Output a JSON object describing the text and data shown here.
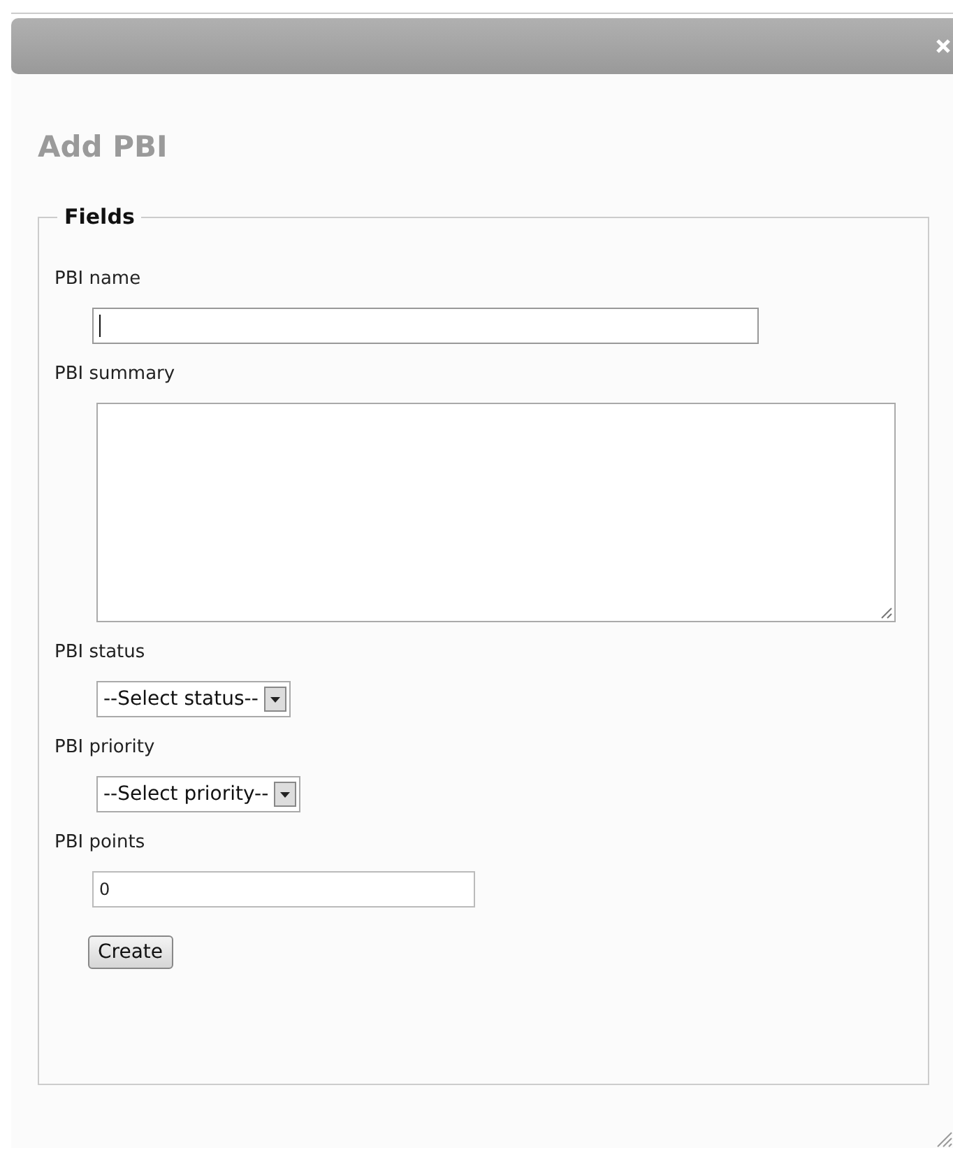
{
  "dialog": {
    "title": "Add PBI"
  },
  "fieldset": {
    "legend": "Fields"
  },
  "fields": [
    {
      "kind": "text",
      "label": "PBI name",
      "focused": true
    },
    {
      "kind": "textarea",
      "label": "PBI summary"
    },
    {
      "kind": "select",
      "label": "PBI status",
      "value": "--Select status--"
    },
    {
      "kind": "select",
      "label": "PBI priority",
      "value": "--Select priority--"
    },
    {
      "kind": "short",
      "label": "PBI points",
      "value": "0",
      "focused": false
    }
  ],
  "buttons": [
    "Create"
  ]
}
